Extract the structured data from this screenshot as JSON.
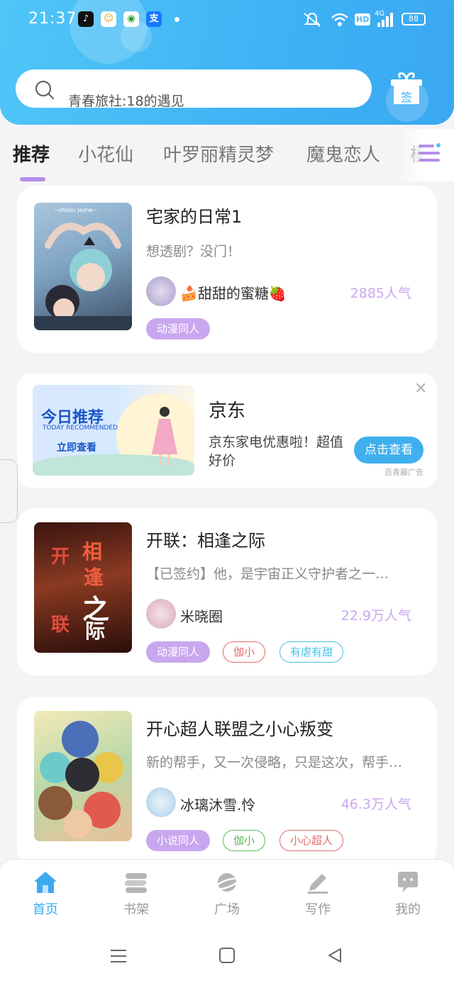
{
  "status_bar": {
    "time": "21:37",
    "signal_label": "4G",
    "hd_label": "HD",
    "battery": "88"
  },
  "search": {
    "placeholder_text": "青春旅社:18的遇见"
  },
  "gift": {
    "label": "签"
  },
  "tabs": [
    {
      "label": "推荐",
      "active": true
    },
    {
      "label": "小花仙"
    },
    {
      "label": "叶罗丽精灵梦"
    },
    {
      "label": "魔鬼恋人"
    },
    {
      "label": "模"
    }
  ],
  "books": [
    {
      "title": "宅家的日常1",
      "desc": "想透剧？没门！",
      "author": "🍰甜甜的蜜糖🍓",
      "popularity": "2885人气",
      "tags": [
        {
          "label": "动漫同人",
          "style": "fill"
        }
      ]
    },
    {
      "title": "开联：相逢之际",
      "desc": "【已签约】他，是宇宙正义守护者之一…",
      "author": "米晓圈",
      "popularity": "22.9万人气",
      "cover_text": [
        "开",
        "相",
        "逢",
        "之",
        "联",
        "际"
      ],
      "tags": [
        {
          "label": "动漫同人",
          "style": "fill"
        },
        {
          "label": "伽小",
          "style": "red"
        },
        {
          "label": "有虐有甜",
          "style": "cyan"
        }
      ]
    },
    {
      "title": "开心超人联盟之小心叛变",
      "desc": "新的帮手，又一次侵略，只是这次，帮手…",
      "author": "冰璃沐雪.怜",
      "popularity": "46.3万人气",
      "tags": [
        {
          "label": "小说同人",
          "style": "fill"
        },
        {
          "label": "伽小",
          "style": "green"
        },
        {
          "label": "小心超人",
          "style": "red"
        }
      ]
    }
  ],
  "ad": {
    "image_title": "今日推荐",
    "image_subtitle": "TODAY RECOMMENDED",
    "image_button": "立即查看",
    "title": "京东",
    "desc": "京东家电优惠啦！超值好价",
    "button": "点击查看",
    "source": "百青藤广告",
    "close": "×"
  },
  "cover1_text": "~shiqiu Jeshe~",
  "bottom_nav": [
    {
      "label": "首页",
      "icon": "home-icon",
      "active": true
    },
    {
      "label": "书架",
      "icon": "bookshelf-icon"
    },
    {
      "label": "广场",
      "icon": "planet-icon"
    },
    {
      "label": "写作",
      "icon": "pen-icon"
    },
    {
      "label": "我的",
      "icon": "chat-icon"
    }
  ],
  "colors": {
    "accent": "#3aaaf0",
    "tag_purple": "#c9a7ee",
    "header": "#45bdf7"
  }
}
